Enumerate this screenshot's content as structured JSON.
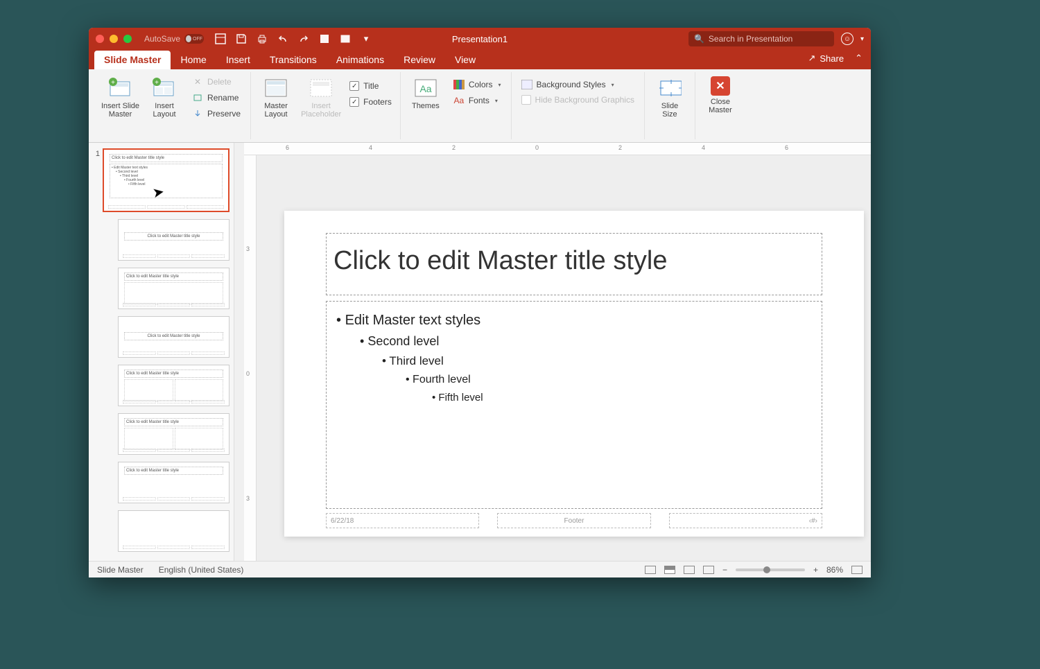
{
  "title": "Presentation1",
  "autosave": {
    "label": "AutoSave",
    "state": "OFF"
  },
  "search_placeholder": "Search in Presentation",
  "tabs": [
    "Slide Master",
    "Home",
    "Insert",
    "Transitions",
    "Animations",
    "Review",
    "View"
  ],
  "active_tab": "Slide Master",
  "share_label": "Share",
  "ribbon": {
    "insert_slide_master": "Insert Slide\nMaster",
    "insert_layout": "Insert\nLayout",
    "delete": "Delete",
    "rename": "Rename",
    "preserve": "Preserve",
    "master_layout": "Master\nLayout",
    "insert_placeholder": "Insert\nPlaceholder",
    "title_chk": "Title",
    "footers_chk": "Footers",
    "themes": "Themes",
    "colors": "Colors",
    "fonts": "Fonts",
    "background_styles": "Background Styles",
    "hide_bg": "Hide Background Graphics",
    "slide_size": "Slide\nSize",
    "close_master": "Close\nMaster"
  },
  "thumbnails": {
    "master_number": "1",
    "master_title": "Click to edit Master title style",
    "master_body": "• Edit Master text styles",
    "layout_title": "Click to edit Master title style"
  },
  "slide": {
    "title": "Click to edit Master title style",
    "lv1": "Edit Master text styles",
    "lv2": "Second level",
    "lv3": "Third level",
    "lv4": "Fourth level",
    "lv5": "Fifth level",
    "date": "6/22/18",
    "footer": "Footer",
    "pagenum": "‹#›"
  },
  "status": {
    "mode": "Slide Master",
    "lang": "English (United States)",
    "zoom": "86%"
  }
}
